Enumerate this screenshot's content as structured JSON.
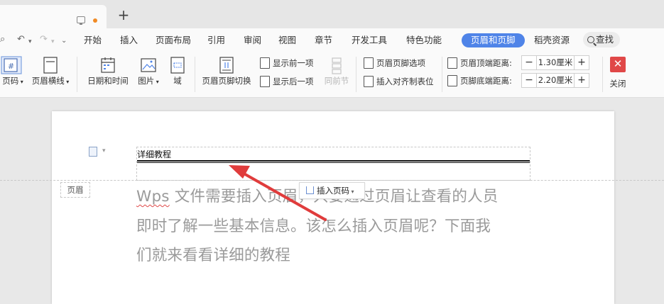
{
  "tabbar": {
    "new_tab": "+"
  },
  "menubar": {
    "items": [
      "开始",
      "插入",
      "页面布局",
      "引用",
      "审阅",
      "视图",
      "章节",
      "开发工具",
      "特色功能"
    ],
    "active": "页眉和页脚",
    "extra": "稻壳资源",
    "search": "查找"
  },
  "ribbon": {
    "page_number": "页码",
    "header_line": "页眉横线",
    "date_time": "日期和时间",
    "picture": "图片",
    "field": "域",
    "switch": "页眉页脚切换",
    "show_prev": "显示前一项",
    "show_next": "显示后一项",
    "same_as_prev": "同前节",
    "hf_options": "页眉页脚选项",
    "insert_tab": "插入对齐制表位",
    "top_label": "页眉顶端距离:",
    "top_value": "1.30厘米",
    "bottom_label": "页脚底端距离:",
    "bottom_value": "2.20厘米",
    "close": "关闭",
    "minus": "−",
    "plus": "+"
  },
  "document": {
    "header_text": "详细教程",
    "header_tag": "页眉",
    "insert_page_number": "插入页码",
    "body_line1_prefix": "Wps",
    "body_line1": " 文件需要插入页眉，只要通过页眉让查看的人员",
    "body_line2": "即时了解一些基本信息。该怎么插入页眉呢？下面我",
    "body_line3": "们就来看看详细的教程"
  },
  "colors": {
    "accent": "#4f84e8",
    "close": "#e04848",
    "arrow": "#e03c3c"
  }
}
